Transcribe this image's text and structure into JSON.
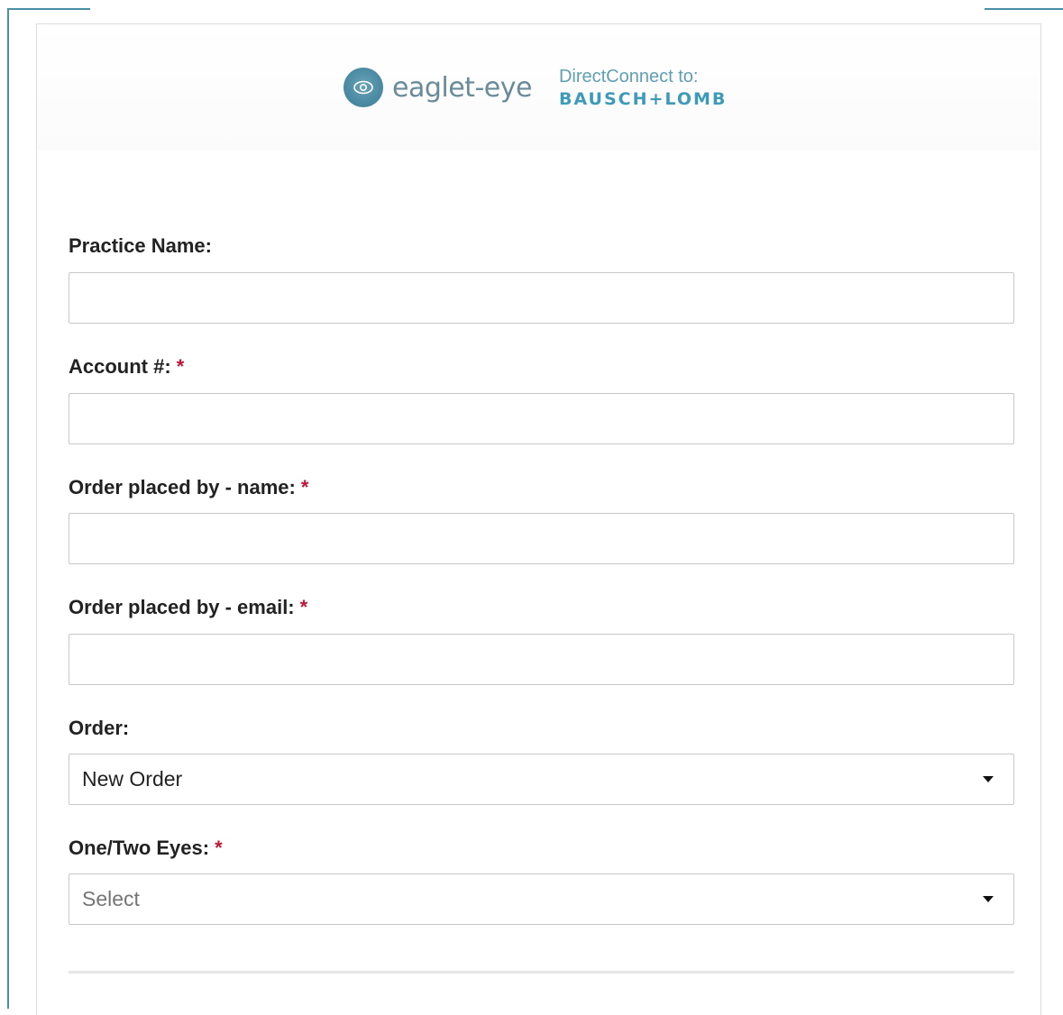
{
  "header": {
    "brand_name": "eaglet-eye",
    "direct_connect": "DirectConnect to:",
    "partner_name": "BAUSCH+LOMB",
    "accent_color": "#4a8fa6"
  },
  "form": {
    "practice_name": {
      "label": "Practice Name:",
      "value": "",
      "required": false
    },
    "account": {
      "label": "Account #:",
      "value": "",
      "required": true
    },
    "placed_by_name": {
      "label": "Order placed by - name:",
      "value": "",
      "required": true
    },
    "placed_by_email": {
      "label": "Order placed by - email:",
      "value": "",
      "required": true
    },
    "order": {
      "label": "Order:",
      "selected": "New Order"
    },
    "eyes": {
      "label": "One/Two Eyes:",
      "placeholder": "Select",
      "required": true
    },
    "required_marker": "*"
  }
}
